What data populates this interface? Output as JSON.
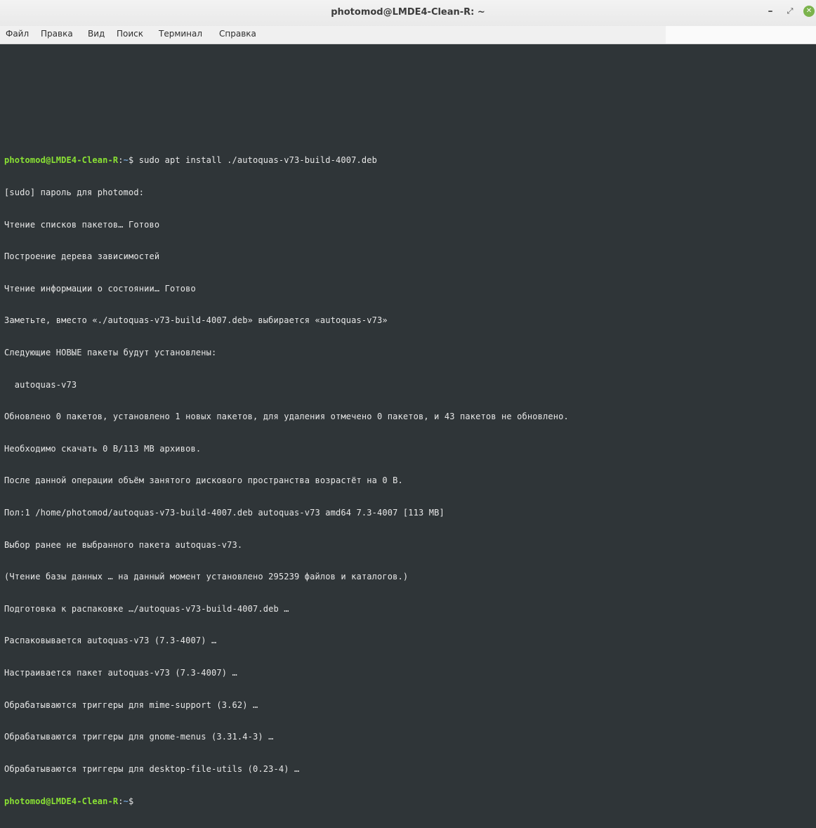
{
  "window": {
    "title": "photomod@LMDE4-Clean-R: ~",
    "controls": {
      "minimize": "–",
      "maximize": "⤢",
      "close": "✕"
    }
  },
  "menu": {
    "items": [
      "Файл",
      "Правка",
      "Вид",
      "Поиск",
      "Терминал",
      "Справка"
    ]
  },
  "terminal": {
    "prompt_user_host": "photomod@LMDE4-Clean-R",
    "prompt_path_sep": ":",
    "prompt_path": "~",
    "prompt_symbol": "$",
    "command": " sudo apt install ./autoquas-v73-build-4007.deb",
    "output_lines": [
      "[sudo] пароль для photomod:",
      "Чтение списков пакетов… Готово",
      "Построение дерева зависимостей",
      "Чтение информации о состоянии… Готово",
      "Заметьте, вместо «./autoquas-v73-build-4007.deb» выбирается «autoquas-v73»",
      "Следующие НОВЫЕ пакеты будут установлены:",
      "  autoquas-v73",
      "Обновлено 0 пакетов, установлено 1 новых пакетов, для удаления отмечено 0 пакетов, и 43 пакетов не обновлено.",
      "Необходимо скачать 0 В/113 МВ архивов.",
      "После данной операции объём занятого дискового пространства возрастёт на 0 В.",
      "Пол:1 /home/photomod/autoquas-v73-build-4007.deb autoquas-v73 amd64 7.3-4007 [113 MB]",
      "Выбор ранее не выбранного пакета autoquas-v73.",
      "(Чтение базы данных … на данный момент установлено 295239 файлов и каталогов.)",
      "Подготовка к распаковке …/autoquas-v73-build-4007.deb …",
      "Распаковывается autoquas-v73 (7.3-4007) …",
      "Настраивается пакет autoquas-v73 (7.3-4007) …",
      "Обрабатываются триггеры для mime-support (3.62) …",
      "Обрабатываются триггеры для gnome-menus (3.31.4-3) …",
      "Обрабатываются триггеры для desktop-file-utils (0.23-4) …"
    ]
  },
  "colors": {
    "terminal_bg": "#2f3538",
    "terminal_fg": "#e8e8e8",
    "prompt_user": "#8ae234",
    "prompt_path": "#729fcf",
    "close_button": "#7bb34c"
  }
}
